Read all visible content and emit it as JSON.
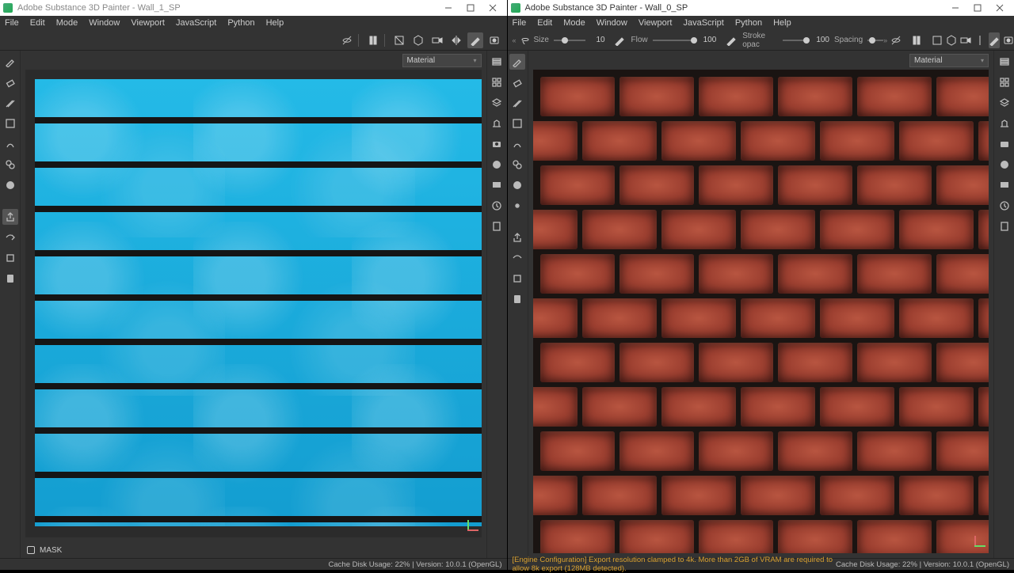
{
  "app_name": "Adobe Substance 3D Painter",
  "left": {
    "title": "Adobe Substance 3D Painter - Wall_1_SP",
    "menus": [
      "File",
      "Edit",
      "Mode",
      "Window",
      "Viewport",
      "JavaScript",
      "Python",
      "Help"
    ],
    "channel": "Material",
    "mask_label": "MASK",
    "status": "Cache Disk Usage:   22% | Version: 10.0.1 (OpenGL)"
  },
  "right": {
    "title": "Adobe Substance 3D Painter - Wall_0_SP",
    "menus": [
      "File",
      "Edit",
      "Mode",
      "Window",
      "Viewport",
      "JavaScript",
      "Python",
      "Help"
    ],
    "brush": {
      "size_label": "Size",
      "size_val": "10",
      "flow_label": "Flow",
      "flow_val": "100",
      "opac_label": "Stroke opac",
      "opac_val": "100",
      "spacing_label": "Spacing"
    },
    "channel": "Material",
    "status_warn": "[Engine Configuration] Export resolution clamped to 4k. More than 2GB of VRAM are required to allow 8k export (128MB detected).",
    "status": "Cache Disk Usage:   22% | Version: 10.0.1 (OpenGL)"
  },
  "icons": {
    "paint": "brush",
    "erase": "eraser",
    "proj": "project",
    "poly": "polyfill",
    "smudge": "smudge",
    "clone": "clone",
    "mat": "material"
  }
}
